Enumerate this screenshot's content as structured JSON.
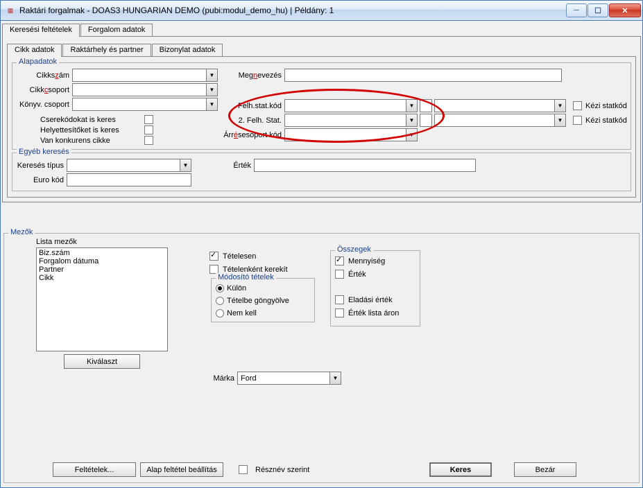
{
  "window": {
    "title": "Raktári forgalmak - DOAS3 HUNGARIAN DEMO (pubi:modul_demo_hu) | Példány: 1"
  },
  "tabs_outer": {
    "search": "Keresési feltételek",
    "forgalom": "Forgalom adatok"
  },
  "tabs_inner": {
    "cikk": "Cikk adatok",
    "raktar": "Raktárhely és partner",
    "bizonylat": "Bizonylat adatok"
  },
  "alapadatok": {
    "legend": "Alapadatok",
    "cikkszam_lbl_pre": "Cikks",
    "cikkszam_lbl_mn": "z",
    "cikkszam_lbl_post": "ám",
    "cikkcsoport_lbl_pre": "Cikk",
    "cikkcsoport_lbl_mn": "c",
    "cikkcsoport_lbl_post": "soport",
    "konyv_lbl": "Könyv. csoport",
    "megnevezes_lbl_pre": "Meg",
    "megnevezes_lbl_mn": "n",
    "megnevezes_lbl_post": "evezés",
    "felh_lbl": "Felh.stat.kód",
    "felh2_lbl": "2. Felh. Stat.",
    "arres_lbl_pre": "Árr",
    "arres_lbl_mn": "é",
    "arres_lbl_post": "sesoport kód",
    "kezi1": "Kézi statkód",
    "kezi2": "Kézi statkód",
    "csere": "Cserekódokat is keres",
    "helyett": "Helyettesítőket is keres",
    "konkurens": "Van konkurens cikke"
  },
  "egyeb": {
    "legend": "Egyéb keresés",
    "tipus": "Keresés típus",
    "ertek": "Érték",
    "euro": "Euro kód"
  },
  "mezok": {
    "legend": "Mezők",
    "lista_label": "Lista mezők",
    "items": [
      "Biz.szám",
      "Forgalom dátuma",
      "Partner",
      "Cikk"
    ],
    "kivalaszt": "Kiválaszt",
    "tetelesen": "Tételesen",
    "tetelkent": "Tételenként kerekít",
    "modosito_legend": "Módosító tételek",
    "kulon": "Külön",
    "gongy": "Tételbe göngyölve",
    "nemkell": "Nem kell",
    "osszegek_legend": "Összegek",
    "mennyiseg": "Mennyiség",
    "ertek": "Érték",
    "eladasi": "Eladási érték",
    "listaaron": "Érték lista áron",
    "marka_lbl": "Márka",
    "marka_val": "Ford"
  },
  "footer": {
    "feltetelek": "Feltételek...",
    "alap": "Alap feltétel beállítás",
    "resznev": "Résznév szerint",
    "keres": "Keres",
    "bezar": "Bezár"
  }
}
